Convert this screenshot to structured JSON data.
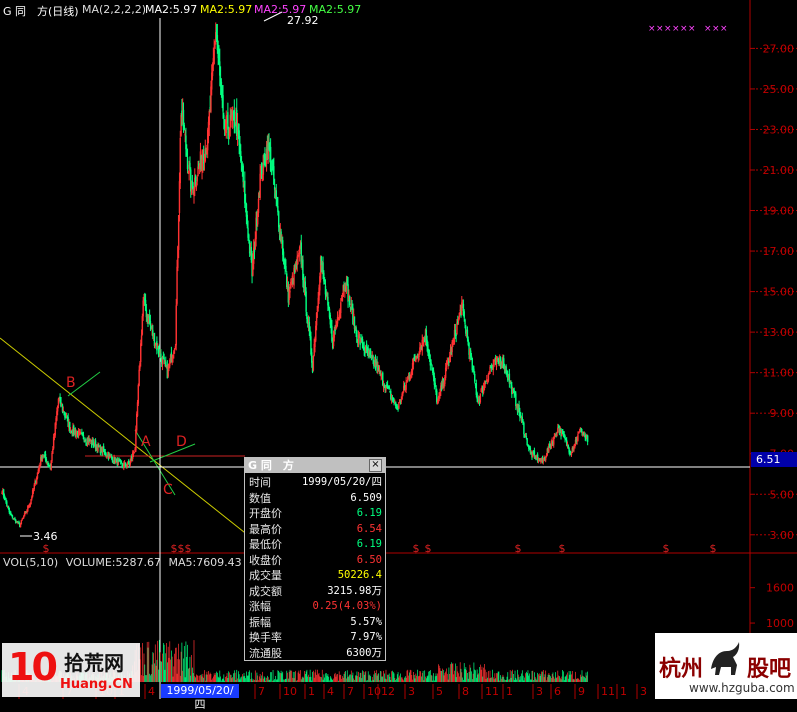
{
  "header": {
    "stock": "G 同　方(日线)",
    "ma_label": "MA(2,2,2,2)",
    "ma1": "MA2:5.97",
    "ma2": "MA2:5.97",
    "ma3": "MA2:5.97",
    "ma4": "MA2:5.97"
  },
  "colors": {
    "up": "#ff3333",
    "down": "#00ff80",
    "axis": "#b00000",
    "ma1": "#ffffff",
    "ma2": "#ffff00",
    "ma3": "#ff00ff",
    "ma4": "#00ff00"
  },
  "annotations": {
    "high": "27.92",
    "low": "3.46",
    "pt_b": "B",
    "pt_a": "A",
    "pt_c": "C",
    "pt_d": "D",
    "cursor_price": "6.51",
    "cursor_date": "1999/05/20/四"
  },
  "volume": {
    "label": "VOL(5,10)",
    "volume_text": "VOLUME:5287.67",
    "ma5_text": "MA5:7609.43"
  },
  "info_window": {
    "title": "G 同　方",
    "close_icon": "×",
    "rows": [
      {
        "k": "时间",
        "v": "1999/05/20/四",
        "color": "#ffffff"
      },
      {
        "k": "数值",
        "v": "6.509",
        "color": "#ffffff"
      },
      {
        "k": "开盘价",
        "v": "6.19",
        "color": "#00ff80"
      },
      {
        "k": "最高价",
        "v": "6.54",
        "color": "#ff3333"
      },
      {
        "k": "最低价",
        "v": "6.19",
        "color": "#00ff80"
      },
      {
        "k": "收盘价",
        "v": "6.50",
        "color": "#ff3333"
      },
      {
        "k": "成交量",
        "v": "50226.4",
        "color": "#ffff00"
      },
      {
        "k": "成交额",
        "v": "3215.98万",
        "color": "#ffffff"
      },
      {
        "k": "涨幅",
        "v": "0.25(4.03%)",
        "color": "#ff3333"
      },
      {
        "k": "振幅",
        "v": "5.57%",
        "color": "#ffffff"
      },
      {
        "k": "换手率",
        "v": "7.97%",
        "color": "#ffffff"
      },
      {
        "k": "流通股",
        "v": "6300万",
        "color": "#ffffff"
      }
    ]
  },
  "watermarks": {
    "left_num": "10",
    "left_cn": "拾荒网",
    "left_en": "Huang.CN",
    "right_cn1": "杭州",
    "right_cn2": "股吧",
    "right_url": "www.hzguba.com"
  },
  "event_marks": [
    "$",
    "$$$",
    "$",
    "$",
    "$",
    "$",
    "$",
    "$"
  ],
  "x_ticks": [
    "4",
    "7",
    "10",
    "1",
    "4",
    "7",
    "10",
    "1",
    "4",
    "7",
    "10",
    "12",
    "3",
    "5",
    "8",
    "11",
    "1",
    "3",
    "6",
    "9",
    "11",
    "1",
    "3",
    "5",
    "7",
    "10",
    "1"
  ],
  "chart_data": {
    "type": "candlestick",
    "title": "G 同　方(日线)",
    "y_ticks": [
      3.0,
      5.0,
      7.0,
      9.0,
      11.0,
      13.0,
      15.0,
      17.0,
      19.0,
      21.0,
      23.0,
      25.0,
      27.0
    ],
    "y_tick_labels": [
      "3.00",
      "5.00",
      "7.00",
      "9.00",
      "11.00",
      "13.00",
      "15.00",
      "17.00",
      "19.00",
      "21.00",
      "23.00",
      "25.00",
      "27.00"
    ],
    "ylim": [
      2.2,
      28.5
    ],
    "vol_ticks": [
      200,
      600,
      1000,
      1600
    ],
    "vol_tick_labels": [
      "200",
      "600",
      "1000",
      "1600"
    ],
    "vol_max": 1900,
    "n_bars": 900,
    "price_path": [
      [
        0,
        5.2
      ],
      [
        10,
        4.0
      ],
      [
        22,
        3.46
      ],
      [
        35,
        4.6
      ],
      [
        50,
        7.0
      ],
      [
        60,
        6.3
      ],
      [
        70,
        9.7
      ],
      [
        85,
        8.2
      ],
      [
        110,
        7.6
      ],
      [
        135,
        6.8
      ],
      [
        150,
        6.4
      ],
      [
        158,
        6.51
      ],
      [
        165,
        7.3
      ],
      [
        175,
        14.5
      ],
      [
        190,
        12.5
      ],
      [
        205,
        11.0
      ],
      [
        215,
        12.6
      ],
      [
        222,
        24.0
      ],
      [
        235,
        20.0
      ],
      [
        255,
        22.5
      ],
      [
        265,
        27.92
      ],
      [
        275,
        23.0
      ],
      [
        290,
        23.5
      ],
      [
        300,
        20.0
      ],
      [
        310,
        15.9
      ],
      [
        320,
        20.6
      ],
      [
        330,
        22.2
      ],
      [
        345,
        18.0
      ],
      [
        355,
        14.8
      ],
      [
        370,
        17.0
      ],
      [
        385,
        11.3
      ],
      [
        395,
        16.6
      ],
      [
        410,
        12.5
      ],
      [
        425,
        15.6
      ],
      [
        440,
        12.8
      ],
      [
        465,
        11.2
      ],
      [
        490,
        9.2
      ],
      [
        510,
        11.5
      ],
      [
        525,
        12.9
      ],
      [
        540,
        9.5
      ],
      [
        555,
        11.8
      ],
      [
        570,
        14.3
      ],
      [
        590,
        9.6
      ],
      [
        605,
        11.2
      ],
      [
        620,
        11.7
      ],
      [
        640,
        9.2
      ],
      [
        655,
        7.0
      ],
      [
        670,
        6.6
      ],
      [
        690,
        8.3
      ],
      [
        705,
        7.1
      ],
      [
        718,
        8.2
      ],
      [
        726,
        7.6
      ]
    ],
    "xlabel": "",
    "ylabel": ""
  }
}
